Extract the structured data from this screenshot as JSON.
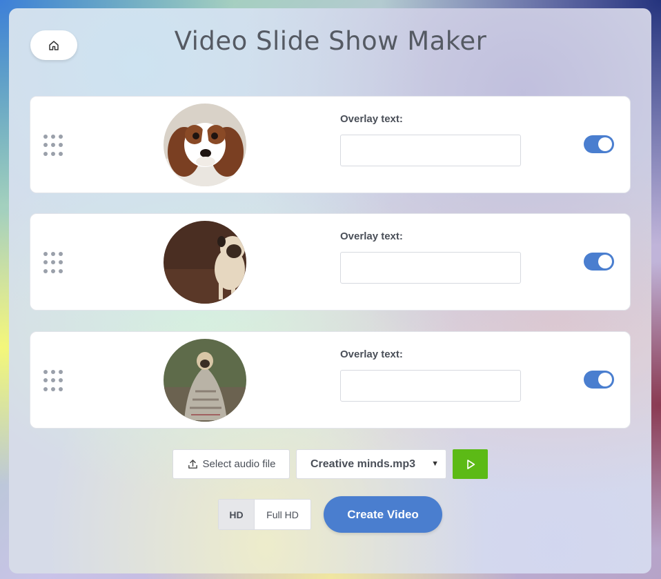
{
  "app": {
    "title": "Video Slide Show Maker"
  },
  "slides": [
    {
      "overlay_label": "Overlay text:",
      "overlay_value": "",
      "enabled": true,
      "image": "spaniel-puppy-photo"
    },
    {
      "overlay_label": "Overlay text:",
      "overlay_value": "",
      "enabled": true,
      "image": "pug-standing-photo"
    },
    {
      "overlay_label": "Overlay text:",
      "overlay_value": "",
      "enabled": true,
      "image": "pug-in-blanket-photo"
    }
  ],
  "audio": {
    "select_button_label": "Select audio file",
    "selected_file": "Creative minds.mp3"
  },
  "quality": {
    "options": [
      "HD",
      "Full HD"
    ],
    "selected": "HD"
  },
  "actions": {
    "create_label": "Create Video"
  },
  "colors": {
    "accent": "#4a7ecf",
    "play": "#5cba16",
    "title_text": "#555a63"
  },
  "icons": {
    "home": "home-icon",
    "drag": "drag-handle-icon",
    "upload": "upload-icon",
    "play": "play-icon",
    "caret": "caret-down-icon"
  }
}
